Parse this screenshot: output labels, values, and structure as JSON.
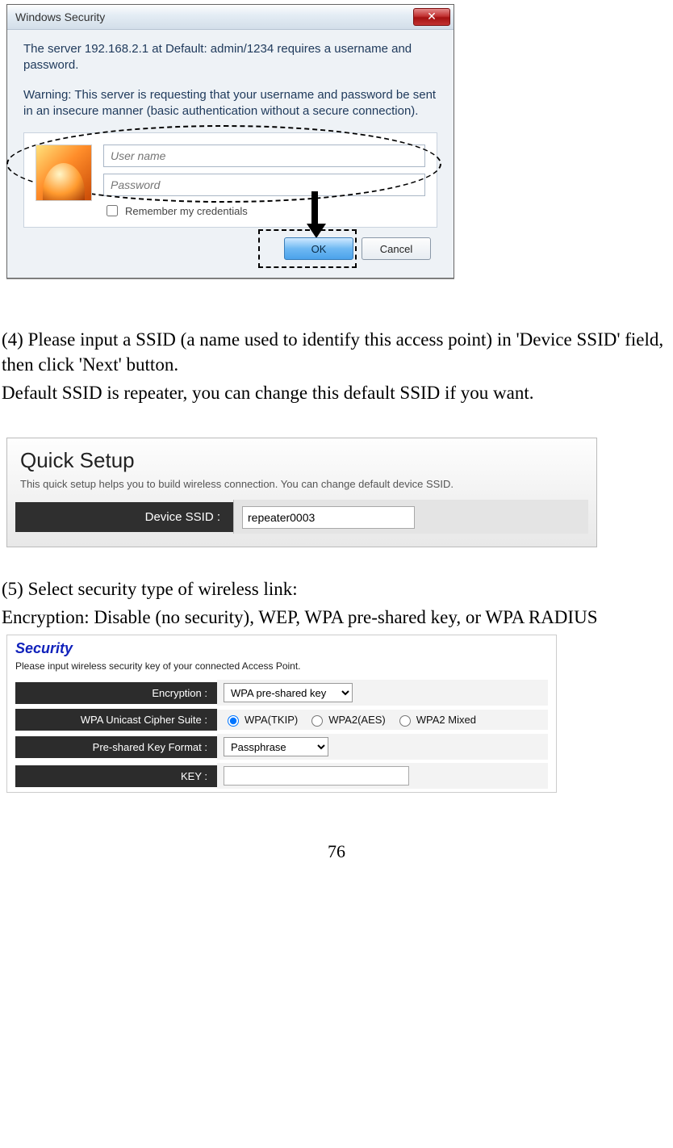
{
  "win_dialog": {
    "title": "Windows Security",
    "close_glyph": "✕",
    "msg1": "The server 192.168.2.1 at Default: admin/1234 requires a username and password.",
    "msg2": "Warning: This server is requesting that your username and password be sent in an insecure manner (basic authentication without a secure connection).",
    "username_placeholder": "User name",
    "password_placeholder": "Password",
    "remember_label": "Remember my credentials",
    "ok_label": "OK",
    "cancel_label": "Cancel"
  },
  "step4": {
    "line1": "(4) Please input a SSID (a name used to identify this access point) in 'Device SSID' field, then click 'Next' button.",
    "line2": "Default SSID is repeater, you can change this default SSID if you want."
  },
  "quick_setup": {
    "title": "Quick Setup",
    "desc": "This quick setup helps you to build wireless connection. You can change default device SSID.",
    "label": "Device SSID :",
    "value": "repeater0003"
  },
  "step5": {
    "line1": "(5) Select security type of wireless link:",
    "line2": "Encryption: Disable (no security), WEP, WPA pre-shared key, or WPA RADIUS"
  },
  "security": {
    "title": "Security",
    "desc": "Please input wireless security key of your connected Access Point.",
    "rows": {
      "encryption_label": "Encryption :",
      "encryption_value": "WPA pre-shared key",
      "cipher_label": "WPA Unicast Cipher Suite :",
      "cipher_options": [
        "WPA(TKIP)",
        "WPA2(AES)",
        "WPA2 Mixed"
      ],
      "keyformat_label": "Pre-shared Key Format :",
      "keyformat_value": "Passphrase",
      "key_label": "KEY :",
      "key_value": ""
    }
  },
  "page_number": "76"
}
